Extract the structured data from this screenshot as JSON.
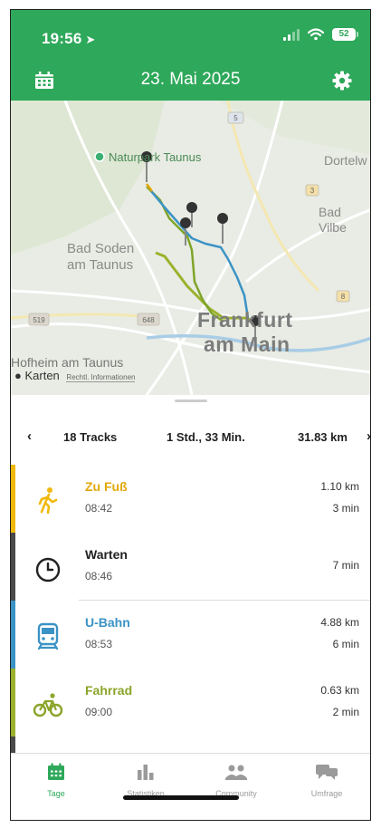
{
  "status": {
    "time": "19:56",
    "battery": "52"
  },
  "header": {
    "date": "23. Mai 2025"
  },
  "map": {
    "labels": {
      "naturpark": "Naturpark Taunus",
      "dortelweil": "Dortelw",
      "bad_vilbel": "Bad Vilbe",
      "bad_soden_1": "Bad Soden",
      "bad_soden_2": "am Taunus",
      "frankfurt_1": "Frankfurt",
      "frankfurt_2": "am Main",
      "hofheim": "Hofheim am Taunus"
    },
    "road_shields": [
      "5",
      "3",
      "8",
      "519",
      "648"
    ],
    "attribution": "Karten",
    "legal": "Rechtl. Informationen"
  },
  "summary": {
    "tracks": "18 Tracks",
    "duration": "1 Std., 33 Min.",
    "distance": "31.83 km",
    "prev": "‹",
    "next": "›"
  },
  "segments": [
    {
      "name": "Zu Fuß",
      "time": "08:42",
      "distance": "1.10 km",
      "duration": "3 min",
      "color": "#f0b90b",
      "name_color": "#e2a80a",
      "icon": "walking-icon"
    },
    {
      "name": "Warten",
      "time": "08:46",
      "distance": "",
      "duration": "7 min",
      "color": "#4a4a4a",
      "name_color": "#222222",
      "icon": "clock-icon"
    },
    {
      "name": "U-Bahn",
      "time": "08:53",
      "distance": "4.88 km",
      "duration": "6 min",
      "color": "#3b93c5",
      "name_color": "#3b93c5",
      "icon": "subway-icon"
    },
    {
      "name": "Fahrrad",
      "time": "09:00",
      "distance": "0.63 km",
      "duration": "2 min",
      "color": "#9bb12c",
      "name_color": "#8ba52a",
      "icon": "bicycle-icon"
    }
  ],
  "tabs": [
    {
      "label": "Tage",
      "icon": "calendar-icon",
      "active": true
    },
    {
      "label": "Statistiken",
      "icon": "bar-chart-icon",
      "active": false
    },
    {
      "label": "Community",
      "icon": "people-icon",
      "active": false
    },
    {
      "label": "Umfrage",
      "icon": "chat-bubbles-icon",
      "active": false
    }
  ],
  "colors": {
    "brand": "#2ea85a",
    "walk": "#f0b90b",
    "subway": "#3b93c5",
    "bike": "#9bb12c",
    "wait": "#4a4a4a"
  }
}
